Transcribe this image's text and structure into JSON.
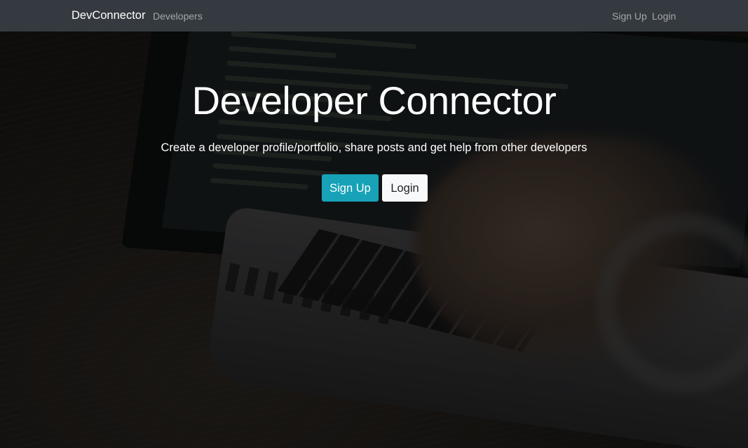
{
  "navbar": {
    "brand": "DevConnector",
    "links": {
      "developers": "Developers",
      "signup": "Sign Up",
      "login": "Login"
    },
    "background_color": "#343a40"
  },
  "hero": {
    "title": "Developer Connector",
    "lead": "Create a developer profile/portfolio, share posts and get help from other developers",
    "buttons": {
      "signup": "Sign Up",
      "login": "Login"
    },
    "colors": {
      "signup_button": "#17a2b8",
      "login_button": "#f8f9fa"
    }
  }
}
